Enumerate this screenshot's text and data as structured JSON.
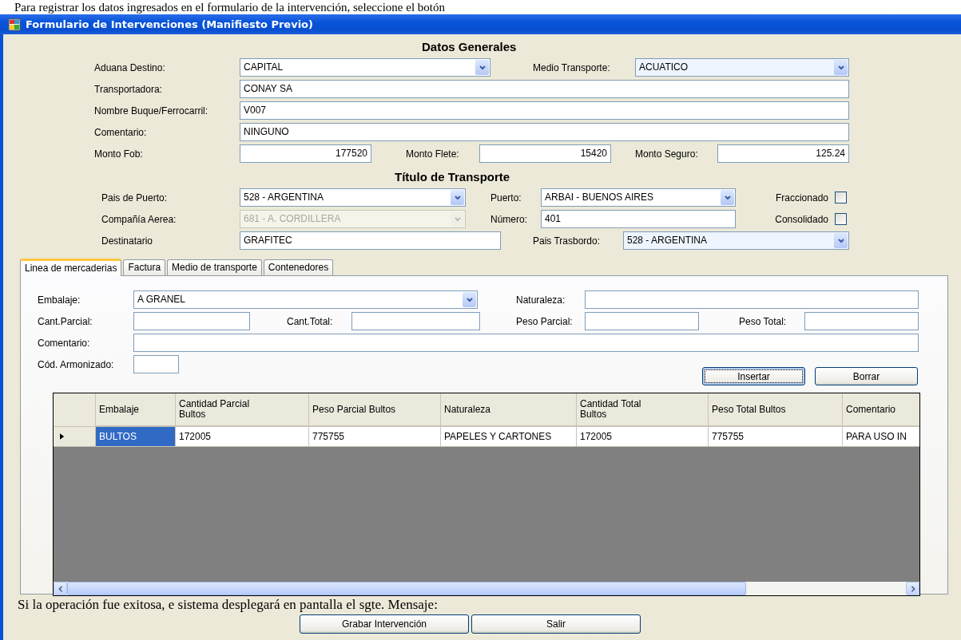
{
  "document_line": "Para registrar los datos ingresados en el formulario de la intervención, seleccione el botón",
  "window": {
    "title": "Formulario de Intervenciones (Manifiesto Previo)"
  },
  "general": {
    "heading": "Datos Generales",
    "aduana_destino": {
      "label": "Aduana Destino:",
      "value": "CAPITAL"
    },
    "medio_transporte": {
      "label": "Medio Transporte:",
      "value": "ACUATICO"
    },
    "transportadora": {
      "label": "Transportadora:",
      "value": "CONAY SA"
    },
    "nombre_buque": {
      "label": "Nombre Buque/Ferrocarril:",
      "value": "V007"
    },
    "comentario": {
      "label": "Comentario:",
      "value": "NINGUNO"
    },
    "monto_fob": {
      "label": "Monto Fob:",
      "value": "177520"
    },
    "monto_flete": {
      "label": "Monto Flete:",
      "value": "15420"
    },
    "monto_seguro": {
      "label": "Monto Seguro:",
      "value": "125.24"
    }
  },
  "transporte": {
    "heading": "Título de Transporte",
    "pais_de_puerto": {
      "label": "Pais de Puerto:",
      "value": "528 - ARGENTINA"
    },
    "puerto": {
      "label": "Puerto:",
      "value": "ARBAI - BUENOS AIRES"
    },
    "fraccionado": {
      "label": "Fraccionado",
      "checked": false
    },
    "compania_aerea": {
      "label": "Compañía Aerea:",
      "value": "681 - A. CORDILLERA",
      "disabled": true
    },
    "numero": {
      "label": "Número:",
      "value": "401"
    },
    "consolidado": {
      "label": "Consolidado",
      "checked": false
    },
    "destinatario": {
      "label": "Destinatario",
      "value": "GRAFITEC"
    },
    "pais_trasbordo": {
      "label": "Pais Trasbordo:",
      "value": "528 - ARGENTINA"
    }
  },
  "tabs": [
    {
      "label": "Linea de mercaderias",
      "selected": true
    },
    {
      "label": "Factura",
      "selected": false
    },
    {
      "label": "Medio de transporte",
      "selected": false
    },
    {
      "label": "Contenedores",
      "selected": false
    }
  ],
  "mercaderias": {
    "embalaje": {
      "label": "Embalaje:",
      "value": "A GRANEL"
    },
    "naturaleza": {
      "label": "Naturaleza:"
    },
    "cant_parcial": {
      "label": "Cant.Parcial:"
    },
    "cant_total": {
      "label": "Cant.Total:"
    },
    "peso_parcial": {
      "label": "Peso Parcial:"
    },
    "peso_total": {
      "label": "Peso Total:"
    },
    "comentario": {
      "label": "Comentario:"
    },
    "cod_armonizado": {
      "label": "Cód. Armonizado:"
    },
    "buttons": [
      {
        "label": "Insertar",
        "focused": true
      },
      {
        "label": "Borrar",
        "focused": false
      }
    ]
  },
  "grid": {
    "columns": [
      "Embalaje",
      "Cantidad Parcial Bultos",
      "Peso Parcial Bultos",
      "Naturaleza",
      "Cantidad Total Bultos",
      "Peso Total Bultos",
      "Comentario"
    ],
    "rows": [
      {
        "current": true,
        "cells": [
          {
            "text": "BULTOS",
            "selected": true
          },
          {
            "text": "172005",
            "selected": false
          },
          {
            "text": "775755",
            "selected": false
          },
          {
            "text": "PAPELES Y CARTONES",
            "selected": false
          },
          {
            "text": "172005",
            "selected": false
          },
          {
            "text": "775755",
            "selected": false
          },
          {
            "text": "PARA USO IN",
            "selected": false
          }
        ]
      }
    ]
  },
  "note": "Si la operación fue exitosa, e sistema desplegará en pantalla el sgte. Mensaje:",
  "footer_buttons": [
    "Grabar Intervención",
    "Salir"
  ]
}
